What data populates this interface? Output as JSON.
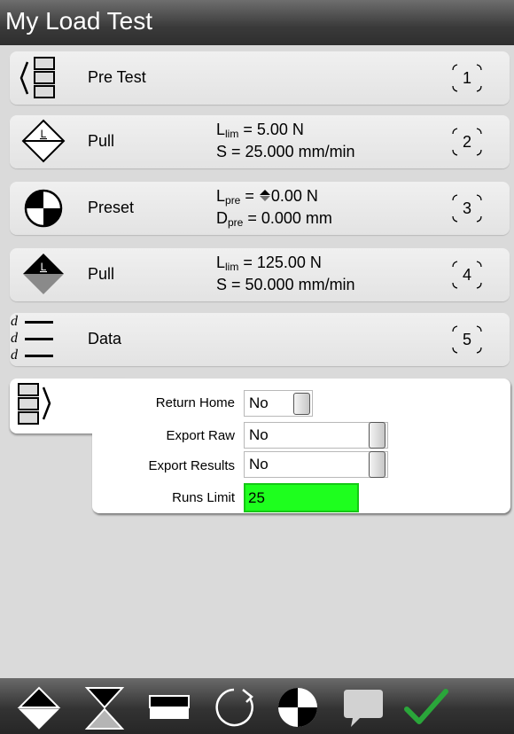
{
  "header": {
    "title": "My Load Test"
  },
  "steps": [
    {
      "number": "1",
      "name": "Pre Test",
      "icon": "pre-test-icon"
    },
    {
      "number": "2",
      "name": "Pull",
      "icon": "pull-icon",
      "param1": {
        "sym": "L",
        "sub": "lim",
        "rest": " = 5.00 N"
      },
      "param2": {
        "text": "S = 25.000 mm/min"
      }
    },
    {
      "number": "3",
      "name": "Preset",
      "icon": "preset-icon",
      "param1": {
        "sym": "L",
        "sub": "pre",
        "mid": " = ",
        "rest": "0.00 N"
      },
      "param2": {
        "sym": "D",
        "sub": "pre",
        "rest": " = 0.000 mm"
      }
    },
    {
      "number": "4",
      "name": "Pull",
      "icon": "pull-icon-filled",
      "param1": {
        "sym": "L",
        "sub": "lim",
        "rest": " = 125.00 N"
      },
      "param2": {
        "text": "S = 50.000 mm/min"
      }
    },
    {
      "number": "5",
      "name": "Data",
      "icon": "data-icon",
      "data_glyph": "d"
    }
  ],
  "options": {
    "return_home": {
      "label": "Return Home",
      "value": "No"
    },
    "export_raw": {
      "label": "Export Raw",
      "value": "No"
    },
    "export_results": {
      "label": "Export Results",
      "value": "No"
    },
    "runs_limit": {
      "label": "Runs Limit",
      "value": "25"
    }
  },
  "toolbar": {
    "items": [
      "pull-step-icon",
      "hold-step-icon",
      "preset-block-icon",
      "cycle-icon",
      "zero-icon",
      "comment-icon",
      "confirm-check-icon"
    ],
    "accent": "#2aa63a"
  }
}
